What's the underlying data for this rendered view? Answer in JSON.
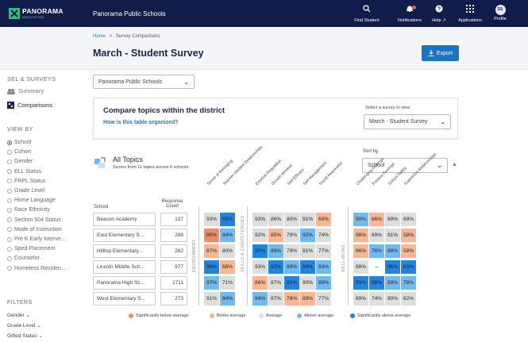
{
  "brand": {
    "name": "PANORAMA",
    "sub": "EDUCATION"
  },
  "org_name": "Panorama Public Schools",
  "topnav": [
    {
      "label": "Find Student",
      "icon": "search-icon",
      "glyph": "⚲"
    },
    {
      "label": "Notifications",
      "icon": "bell-icon",
      "glyph": "🔔"
    },
    {
      "label": "Help ↗",
      "icon": "help-icon",
      "glyph": "?"
    },
    {
      "label": "Applications",
      "icon": "grid-icon",
      "glyph": "⋮⋮⋮"
    },
    {
      "label": "Profile",
      "icon": "avatar",
      "glyph": "SS"
    }
  ],
  "breadcrumb": {
    "home": "Home",
    "sep": ">",
    "current": "Survey Comparisons"
  },
  "page_title": "March - Student Survey",
  "export_label": "Export",
  "sidebar": {
    "sel_heading": "SEL & SURVEYS",
    "items": [
      {
        "label": "Summary"
      },
      {
        "label": "Comparisons"
      }
    ],
    "viewby_heading": "VIEW BY",
    "viewby": [
      "School",
      "Cohort",
      "Gender",
      "ELL Status",
      "FRPL Status",
      "Grade Level",
      "Home Language",
      "Race Ethnicity",
      "Section 504 Status",
      "Mode of Instruction",
      "Pre K Early Interve...",
      "Sped Placement",
      "Counselor",
      "Homeless Residen..."
    ],
    "viewby_selected": 0,
    "filters_heading": "FILTERS",
    "filters": [
      "Gender",
      "Grade Level",
      "Gifted Status"
    ]
  },
  "district_select": "Panorama Public Schools",
  "compare": {
    "title": "Compare topics within the district",
    "link": "How is this table organized?",
    "select_label": "Select a survey to view",
    "select_value": "March - Student Survey"
  },
  "all_topics": {
    "title": "All Topics",
    "subtitle": "Scores from 11 topics across 6 schools"
  },
  "sort": {
    "label": "Sort by",
    "value": "School"
  },
  "table": {
    "school_header": "School",
    "count_header": "Response Count",
    "groups": [
      {
        "label": "ENVIRONMENT",
        "topics": [
          "Sense of Belonging",
          "Teacher-Student Relationships"
        ]
      },
      {
        "label": "SKILLS & COMPETENCIES",
        "topics": [
          "Emotion Regulation",
          "Growth Mindset",
          "Self-Efficacy",
          "Self-Management",
          "Social Awareness"
        ]
      },
      {
        "label": "WELL-BEING",
        "topics": [
          "Challenging Feelings",
          "Positive Feelings",
          "School Safety",
          "Supportive Relationships"
        ]
      }
    ],
    "rows": [
      {
        "school": "Beacon Academy",
        "count": "137",
        "scores": [
          "93%",
          "85%",
          "93%",
          "86%",
          "80%",
          "91%",
          "69%",
          "90%",
          "66%",
          "89%",
          "69%"
        ],
        "levels": [
          2,
          4,
          2,
          2,
          2,
          2,
          1,
          3,
          1,
          2,
          2
        ]
      },
      {
        "school": "East Elementary S...",
        "count": "288",
        "scores": [
          "85%",
          "84%",
          "92%",
          "85%",
          "79%",
          "92%",
          "74%",
          "86%",
          "69%",
          "91%",
          "58%"
        ],
        "levels": [
          0,
          3,
          2,
          1,
          2,
          3,
          2,
          1,
          2,
          2,
          1
        ]
      },
      {
        "school": "Hilltop Elementary...",
        "count": "262",
        "scores": [
          "87%",
          "80%",
          "95%",
          "89%",
          "79%",
          "91%",
          "77%",
          "86%",
          "76%",
          "88%",
          "58%"
        ],
        "levels": [
          1,
          2,
          4,
          3,
          2,
          2,
          2,
          1,
          3,
          3,
          1
        ]
      },
      {
        "school": "Lincoln Middle Sch...",
        "count": "977",
        "scores": [
          "98%",
          "68%",
          "93%",
          "92%",
          "89%",
          "94%",
          "93%",
          "88%",
          "--",
          "96%",
          "83%"
        ],
        "levels": [
          4,
          1,
          2,
          4,
          3,
          4,
          3,
          2,
          5,
          4,
          4
        ]
      },
      {
        "school": "Panorama High Sc...",
        "count": "1711",
        "scores": [
          "97%",
          "71%",
          "86%",
          "87%",
          "91%",
          "90%",
          "89%",
          "93%",
          "88%",
          "88%",
          "78%"
        ],
        "levels": [
          3,
          2,
          1,
          2,
          4,
          2,
          3,
          4,
          4,
          3,
          3
        ]
      },
      {
        "school": "West Elementary S...",
        "count": "273",
        "scores": [
          "91%",
          "84%",
          "94%",
          "87%",
          "78%",
          "89%",
          "77%",
          "89%",
          "74%",
          "90%",
          "62%"
        ],
        "levels": [
          2,
          3,
          3,
          2,
          1,
          1,
          2,
          2,
          2,
          2,
          2
        ]
      }
    ]
  },
  "level_colors": [
    "#f08a6c",
    "#f6b796",
    "#dedede",
    "#74b9ee",
    "#2284e0",
    "#ffffff"
  ],
  "legend": [
    {
      "label": "Significantly below average",
      "color": "#f08a6c"
    },
    {
      "label": "Below average",
      "color": "#f6b796"
    },
    {
      "label": "Average",
      "color": "#dedede"
    },
    {
      "label": "Above average",
      "color": "#74b9ee"
    },
    {
      "label": "Significantly above average",
      "color": "#2284e0"
    }
  ]
}
